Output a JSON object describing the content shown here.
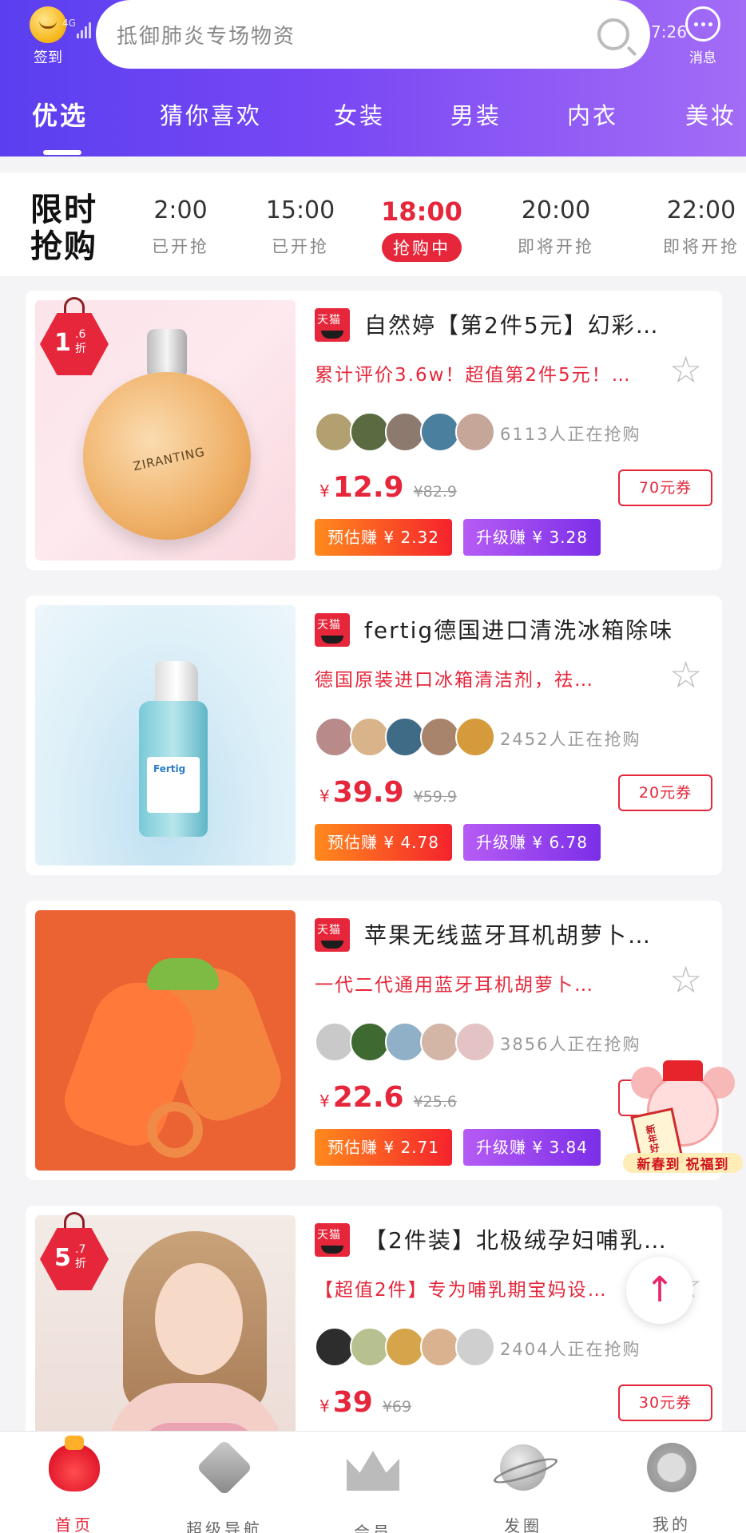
{
  "status_bar": {
    "network": "4G",
    "time": "7:26"
  },
  "header": {
    "checkin_label": "签到",
    "search_placeholder": "抵御肺炎专场物资",
    "message_label": "消息"
  },
  "category_tabs": [
    {
      "label": "优选",
      "active": true
    },
    {
      "label": "猜你喜欢",
      "active": false
    },
    {
      "label": "女装",
      "active": false
    },
    {
      "label": "男装",
      "active": false
    },
    {
      "label": "内衣",
      "active": false
    },
    {
      "label": "美妆",
      "active": false
    }
  ],
  "flash_sale": {
    "logo_line1": "限时",
    "logo_line2": "抢购",
    "slots": [
      {
        "time": "2:00",
        "status": "已开抢",
        "active": false
      },
      {
        "time": "15:00",
        "status": "已开抢",
        "active": false
      },
      {
        "time": "18:00",
        "status": "抢购中",
        "active": true
      },
      {
        "time": "20:00",
        "status": "即将开抢",
        "active": false
      },
      {
        "time": "22:00",
        "status": "即将开抢",
        "active": false
      }
    ]
  },
  "products": [
    {
      "platform": "天猫",
      "discount_num": "1",
      "discount_decimal": ".6",
      "discount_unit": "折",
      "image_label": "ZIRANTING",
      "title": "自然婷【第2件5元】幻彩…",
      "subtitle": "累计评价3.6w！超值第2件5元！…",
      "buyers": "6113人正在抢购",
      "currency": "¥",
      "price": "12.9",
      "original_price": "¥82.9",
      "coupon": "70元券",
      "earn": "预估赚 ¥ 2.32",
      "upgrade": "升级赚 ¥ 3.28",
      "avatar_colors": [
        "#b3a070",
        "#5a6b42",
        "#8b7a6d",
        "#4a7f9e",
        "#c7a69a"
      ]
    },
    {
      "platform": "天猫",
      "title": "fertig德国进口清洗冰箱除味",
      "subtitle": "德国原装进口冰箱清洁剂，祛…",
      "buyers": "2452人正在抢购",
      "currency": "¥",
      "price": "39.9",
      "original_price": "¥59.9",
      "coupon": "20元券",
      "earn": "预估赚 ¥ 4.78",
      "upgrade": "升级赚 ¥ 6.78",
      "avatar_colors": [
        "#b88a8a",
        "#d9b48a",
        "#3f6b86",
        "#a8846c",
        "#d59a3c"
      ]
    },
    {
      "platform": "天猫",
      "title": "苹果无线蓝牙耳机胡萝卜…",
      "subtitle": "一代二代通用蓝牙耳机胡萝卜…",
      "buyers": "3856人正在抢购",
      "currency": "¥",
      "price": "22.6",
      "original_price": "¥25.6",
      "coupon": "",
      "earn": "预估赚 ¥ 2.71",
      "upgrade": "升级赚 ¥ 3.84",
      "avatar_colors": [
        "#c9c9c9",
        "#3e6a32",
        "#8fb0c7",
        "#d4b6a7",
        "#e3c3c3"
      ]
    },
    {
      "platform": "天猫",
      "discount_num": "5",
      "discount_decimal": ".7",
      "discount_unit": "折",
      "title": "【2件装】北极绒孕妇哺乳…",
      "subtitle": "【超值2件】专为哺乳期宝妈设…",
      "buyers": "2404人正在抢购",
      "currency": "¥",
      "price": "39",
      "original_price": "¥69",
      "coupon": "30元券",
      "avatar_colors": [
        "#2d2d2d",
        "#b7c18f",
        "#d6a44a",
        "#d9b38f",
        "#cfcfcf"
      ]
    }
  ],
  "floating": {
    "promo_text": "新春到 祝福到",
    "promo_badge": "新年好"
  },
  "bottom_nav": [
    {
      "label": "首页",
      "icon": "red-bag-icon",
      "active": true
    },
    {
      "label": "超级导航",
      "icon": "diamond-icon",
      "active": false
    },
    {
      "label": "会员",
      "icon": "crown-icon",
      "active": false
    },
    {
      "label": "发圈",
      "icon": "planet-icon",
      "active": false
    },
    {
      "label": "我的",
      "icon": "lion-icon",
      "active": false
    }
  ],
  "colors": {
    "header_gradient_start": "#5a3ff0",
    "header_gradient_end": "#a36cf6",
    "accent_red": "#e6263a",
    "earn_orange": "#ff8a1c",
    "upgrade_purple": "#7b2ee8"
  }
}
